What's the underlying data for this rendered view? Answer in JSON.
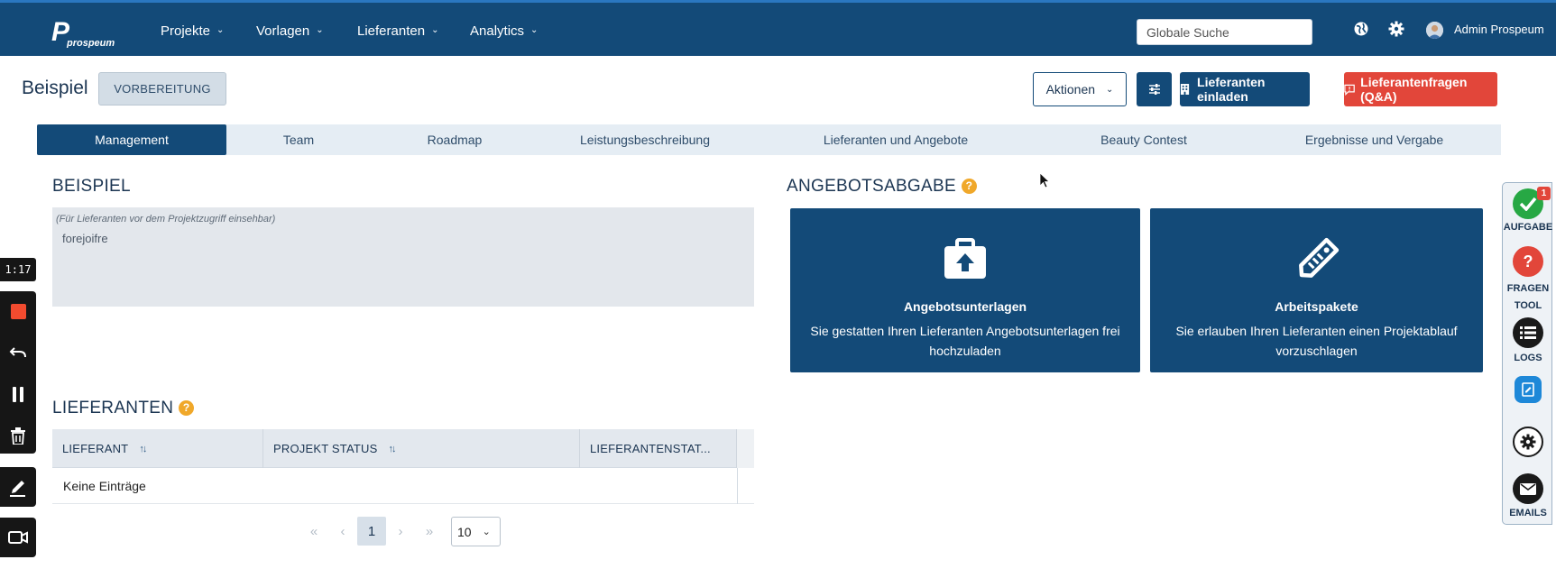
{
  "header": {
    "logo_text": "prospeum",
    "nav": [
      {
        "label": "Projekte"
      },
      {
        "label": "Vorlagen"
      },
      {
        "label": "Lieferanten"
      },
      {
        "label": "Analytics"
      }
    ],
    "search_placeholder": "Globale Suche",
    "user_name": "Admin Prospeum"
  },
  "page": {
    "title": "Beispiel",
    "status": "VORBEREITUNG",
    "actions_label": "Aktionen",
    "invite_label": "Lieferanten einladen",
    "qa_label": "Lieferantenfragen (Q&A)"
  },
  "tabs": [
    {
      "label": "Management",
      "active": true
    },
    {
      "label": "Team"
    },
    {
      "label": "Roadmap"
    },
    {
      "label": "Leistungsbeschreibung"
    },
    {
      "label": "Lieferanten und Angebote"
    },
    {
      "label": "Beauty Contest"
    },
    {
      "label": "Ergebnisse und Vergabe"
    }
  ],
  "description": {
    "title": "BEISPIEL",
    "hint": "(Für Lieferanten vor dem Projektzugriff einsehbar)",
    "text": "forejoifre"
  },
  "offer": {
    "title": "ANGEBOTSABGABE",
    "help": "?",
    "cards": [
      {
        "title": "Angebotsunterlagen",
        "desc": "Sie gestatten Ihren Lieferanten Angebotsunterlagen frei hochzuladen",
        "icon": "briefcase-upload-icon"
      },
      {
        "title": "Arbeitspakete",
        "desc": "Sie erlauben Ihren Lieferanten einen Projektablauf vorzuschlagen",
        "icon": "tag-icon"
      }
    ]
  },
  "suppliers": {
    "title": "LIEFERANTEN",
    "help": "?",
    "columns": [
      "LIEFERANT",
      "PROJEKT STATUS",
      "LIEFERANTENSTAT..."
    ],
    "empty": "Keine Einträge",
    "current_page": "1",
    "per_page": "10",
    "pager_symbols": {
      "first": "«",
      "prev": "‹",
      "next": "›",
      "last": "»"
    }
  },
  "recorder": {
    "timer": "1:17"
  },
  "side_tools": [
    {
      "label": "AUFGABE",
      "badge": "1"
    },
    {
      "label": "FRAGEN TOOL"
    },
    {
      "label": "LOGS"
    },
    {
      "label": ""
    },
    {
      "label": ""
    },
    {
      "label": "EMAILS"
    }
  ],
  "colors": {
    "primary": "#134a78",
    "danger": "#e2463a",
    "help": "#f0a82a",
    "tab_bg": "#e5edf4",
    "success": "#27a844"
  }
}
